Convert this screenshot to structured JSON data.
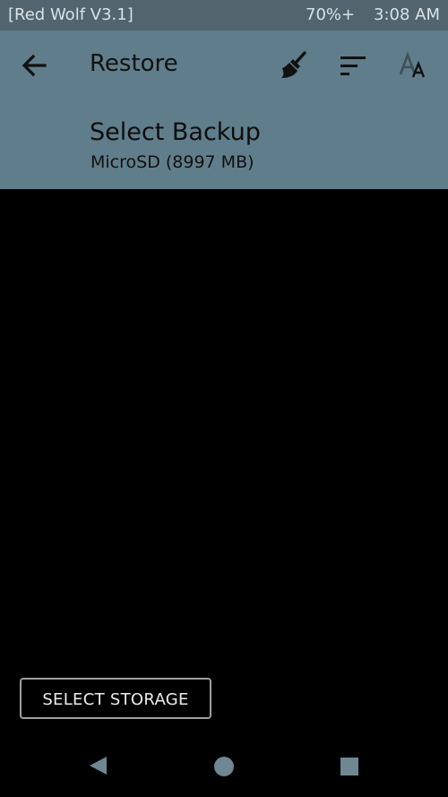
{
  "status_bar": {
    "title": "[Red Wolf V3.1]",
    "battery": "70%+",
    "clock": "3:08 AM"
  },
  "toolbar": {
    "title": "Restore",
    "icons": [
      "back-arrow-icon",
      "broom-icon",
      "sort-icon",
      "font-size-icon"
    ]
  },
  "subheader": {
    "title": "Select Backup",
    "storage": "MicroSD (8997 MB)"
  },
  "actions": {
    "select_storage_label": "SELECT STORAGE"
  },
  "nav_bar": {
    "icons": [
      "back-triangle-icon",
      "home-circle-icon",
      "recents-square-icon"
    ]
  },
  "colors": {
    "status_bar_bg": "#52646e",
    "toolbar_bg": "#607d8b",
    "content_bg": "#000000",
    "nav_icon": "#6f8793"
  }
}
